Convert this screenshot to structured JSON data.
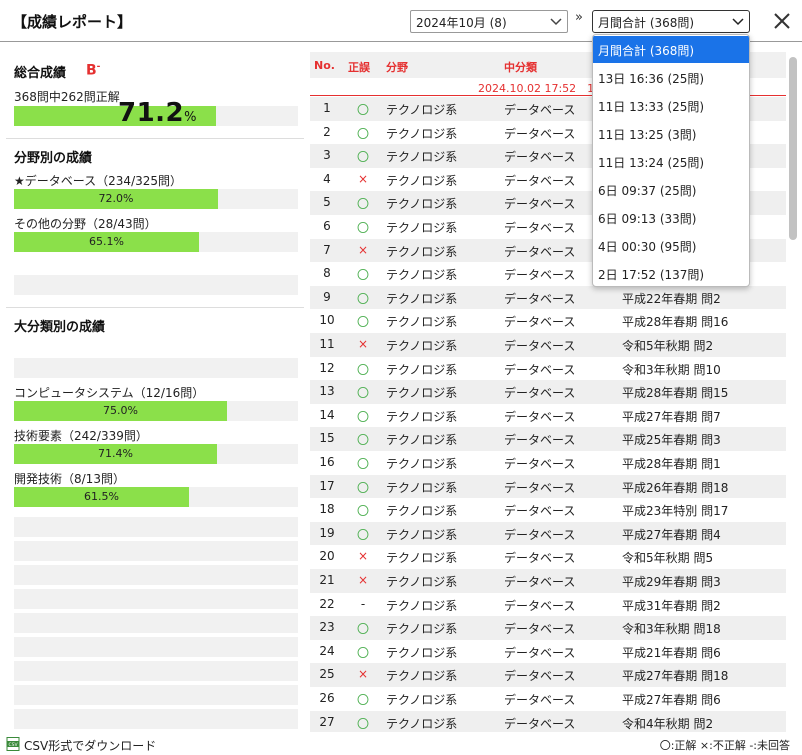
{
  "header": {
    "title": "【成績レポート】",
    "month_value": "2024年10月 (8)",
    "separator": "»",
    "session_value": "月間合計 (368問)"
  },
  "summary": {
    "title": "総合成績",
    "grade": "B",
    "grade_sup": "-",
    "detail": "368問中262問正解",
    "percent": "71.2",
    "percent_unit": "%",
    "fill": 0.712
  },
  "field_section": {
    "title": "分野別の成績",
    "items": [
      {
        "label": "★データベース（234/325問）",
        "pct": "72.0%",
        "fill": 0.72
      },
      {
        "label": "その他の分野（28/43問）",
        "pct": "65.1%",
        "fill": 0.651
      }
    ]
  },
  "category_section": {
    "title": "大分類別の成績",
    "items": [
      {
        "label": "コンピュータシステム（12/16問）",
        "pct": "75.0%",
        "fill": 0.75
      },
      {
        "label": "技術要素（242/339問）",
        "pct": "71.4%",
        "fill": 0.714
      },
      {
        "label": "開発技術（8/13問）",
        "pct": "61.5%",
        "fill": 0.615
      }
    ]
  },
  "table": {
    "headers": {
      "no": "No.",
      "mark": "正誤",
      "field": "分野",
      "mid": "中分類"
    },
    "date_label": "2024.10.02 17:52　1",
    "rows": [
      {
        "no": "1",
        "mark": "〇",
        "field": "テクノロジ系",
        "mid": "データベース",
        "src": ""
      },
      {
        "no": "2",
        "mark": "〇",
        "field": "テクノロジ系",
        "mid": "データベース",
        "src": ""
      },
      {
        "no": "3",
        "mark": "〇",
        "field": "テクノロジ系",
        "mid": "データベース",
        "src": ""
      },
      {
        "no": "4",
        "mark": "×",
        "field": "テクノロジ系",
        "mid": "データベース",
        "src": ""
      },
      {
        "no": "5",
        "mark": "〇",
        "field": "テクノロジ系",
        "mid": "データベース",
        "src": ""
      },
      {
        "no": "6",
        "mark": "〇",
        "field": "テクノロジ系",
        "mid": "データベース",
        "src": ""
      },
      {
        "no": "7",
        "mark": "×",
        "field": "テクノロジ系",
        "mid": "データベース",
        "src": ""
      },
      {
        "no": "8",
        "mark": "〇",
        "field": "テクノロジ系",
        "mid": "データベース",
        "src": ""
      },
      {
        "no": "9",
        "mark": "〇",
        "field": "テクノロジ系",
        "mid": "データベース",
        "src": "平成22年春期 問2"
      },
      {
        "no": "10",
        "mark": "〇",
        "field": "テクノロジ系",
        "mid": "データベース",
        "src": "平成28年春期 問16"
      },
      {
        "no": "11",
        "mark": "×",
        "field": "テクノロジ系",
        "mid": "データベース",
        "src": "令和5年秋期 問2"
      },
      {
        "no": "12",
        "mark": "〇",
        "field": "テクノロジ系",
        "mid": "データベース",
        "src": "令和3年秋期 問10"
      },
      {
        "no": "13",
        "mark": "〇",
        "field": "テクノロジ系",
        "mid": "データベース",
        "src": "平成28年春期 問15"
      },
      {
        "no": "14",
        "mark": "〇",
        "field": "テクノロジ系",
        "mid": "データベース",
        "src": "平成27年春期 問7"
      },
      {
        "no": "15",
        "mark": "〇",
        "field": "テクノロジ系",
        "mid": "データベース",
        "src": "平成25年春期 問3"
      },
      {
        "no": "16",
        "mark": "〇",
        "field": "テクノロジ系",
        "mid": "データベース",
        "src": "平成28年春期 問1"
      },
      {
        "no": "17",
        "mark": "〇",
        "field": "テクノロジ系",
        "mid": "データベース",
        "src": "平成26年春期 問18"
      },
      {
        "no": "18",
        "mark": "〇",
        "field": "テクノロジ系",
        "mid": "データベース",
        "src": "平成23年特別 問17"
      },
      {
        "no": "19",
        "mark": "〇",
        "field": "テクノロジ系",
        "mid": "データベース",
        "src": "平成27年春期 問4"
      },
      {
        "no": "20",
        "mark": "×",
        "field": "テクノロジ系",
        "mid": "データベース",
        "src": "令和5年秋期 問5"
      },
      {
        "no": "21",
        "mark": "×",
        "field": "テクノロジ系",
        "mid": "データベース",
        "src": "平成29年春期 問3"
      },
      {
        "no": "22",
        "mark": "-",
        "field": "テクノロジ系",
        "mid": "データベース",
        "src": "平成31年春期 問2"
      },
      {
        "no": "23",
        "mark": "〇",
        "field": "テクノロジ系",
        "mid": "データベース",
        "src": "令和3年秋期 問18"
      },
      {
        "no": "24",
        "mark": "〇",
        "field": "テクノロジ系",
        "mid": "データベース",
        "src": "平成21年春期 問6"
      },
      {
        "no": "25",
        "mark": "×",
        "field": "テクノロジ系",
        "mid": "データベース",
        "src": "平成27年春期 問18"
      },
      {
        "no": "26",
        "mark": "〇",
        "field": "テクノロジ系",
        "mid": "データベース",
        "src": "平成27年春期 問6"
      },
      {
        "no": "27",
        "mark": "〇",
        "field": "テクノロジ系",
        "mid": "データベース",
        "src": "令和4年秋期 問2"
      }
    ]
  },
  "dropdown": {
    "options": [
      "月間合計 (368問)",
      "13日 16:36 (25問)",
      "11日 13:33 (25問)",
      "11日 13:25 (3問)",
      "11日 13:24 (25問)",
      "6日 09:37 (25問)",
      "6日 09:13 (33問)",
      "4日 00:30 (95問)",
      "2日 17:52 (137問)"
    ],
    "selected_index": 0
  },
  "footer": {
    "csv_label": "CSV形式でダウンロード",
    "legend": "〇:正解 ×:不正解 -:未回答"
  },
  "colors": {
    "accent_red": "#e53030",
    "bar_green": "#8be04a",
    "select_blue": "#1a73e8",
    "ok_green": "#4caf50"
  }
}
